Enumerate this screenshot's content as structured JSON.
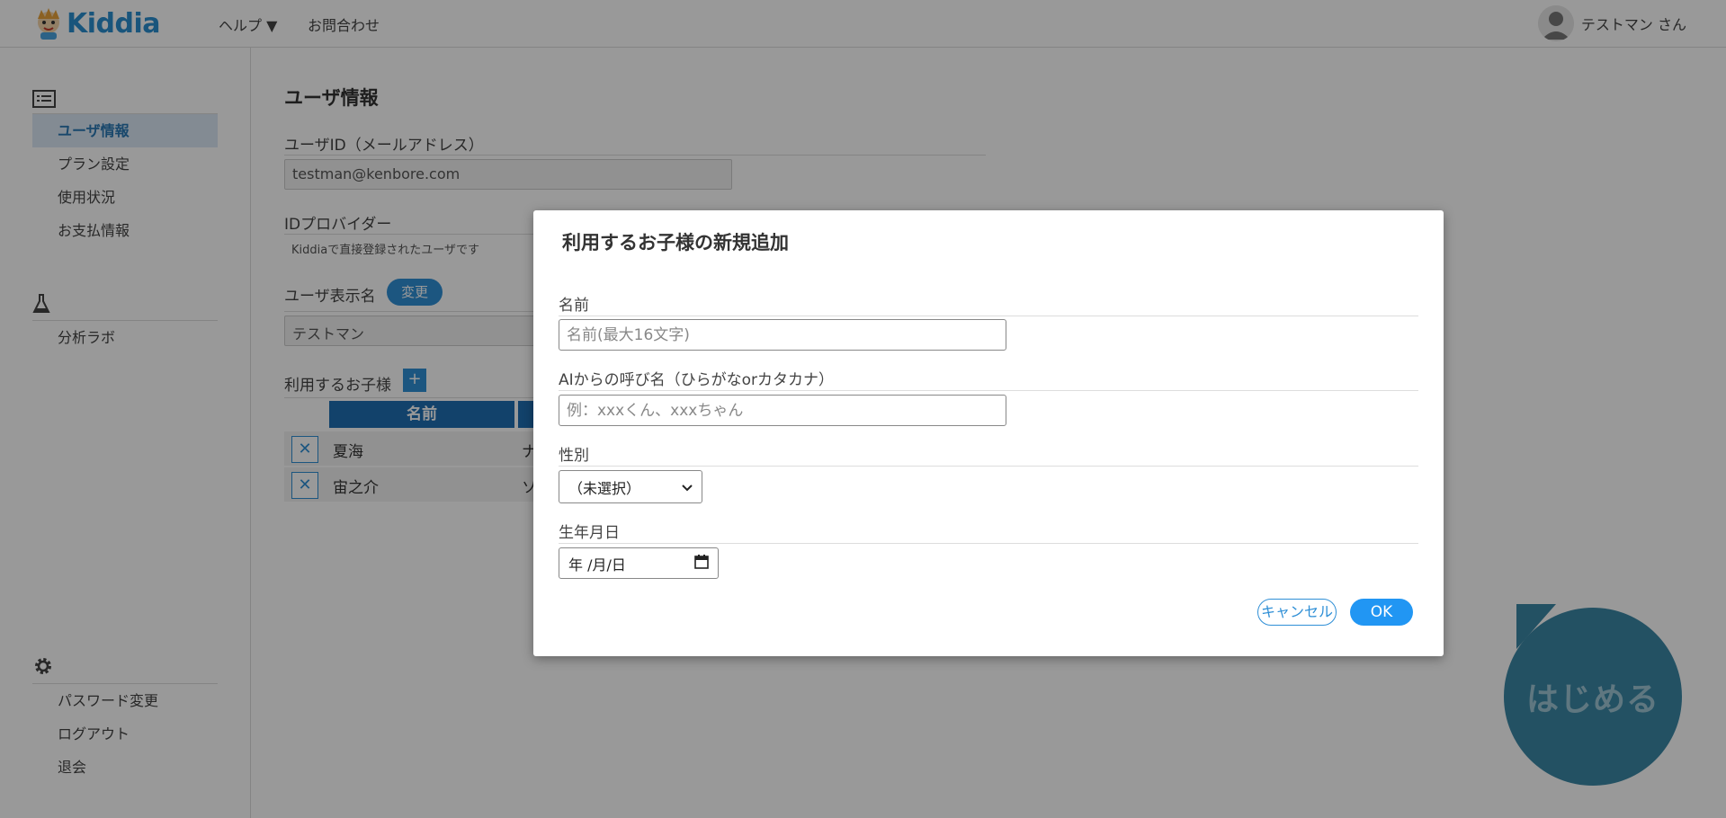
{
  "header": {
    "logo_text": "Kiddia",
    "nav": {
      "help": "ヘルプ ▼",
      "contact": "お問合わせ"
    },
    "user_name": "テストマン さん"
  },
  "sidebar": {
    "account_items": [
      {
        "label": "ユーザ情報",
        "active": true
      },
      {
        "label": "プラン設定"
      },
      {
        "label": "使用状況"
      },
      {
        "label": "お支払情報"
      }
    ],
    "lab_items": [
      {
        "label": "分析ラボ"
      }
    ],
    "settings_items": [
      {
        "label": "パスワード変更"
      },
      {
        "label": "ログアウト"
      },
      {
        "label": "退会"
      }
    ]
  },
  "main": {
    "title": "ユーザ情報",
    "user_id_label": "ユーザID（メールアドレス）",
    "user_id_value": "testman@kenbore.com",
    "id_provider_label": "IDプロバイダー",
    "id_provider_value": "Kiddiaで直接登録されたユーザです",
    "display_name_label": "ユーザ表示名",
    "change_button": "変更",
    "display_name_value": "テストマン",
    "children_label": "利用するお子様",
    "add_button": "+",
    "table_headers": [
      "名前"
    ],
    "children": [
      {
        "name": "夏海",
        "reading": "ナ"
      },
      {
        "name": "宙之介",
        "reading": "ソ"
      }
    ]
  },
  "start_button": "はじめる",
  "modal": {
    "title": "利用するお子様の新規追加",
    "name_label": "名前",
    "name_placeholder": "名前(最大16文字)",
    "nickname_label": "AIからの呼び名（ひらがなorカタカナ）",
    "nickname_placeholder": "例：xxxくん、xxxちゃん",
    "gender_label": "性別",
    "gender_value": "（未選択）",
    "birthday_label": "生年月日",
    "birthday_value": "年 /月/日",
    "cancel_button": "キャンセル",
    "ok_button": "OK"
  },
  "colors": {
    "brand_blue": "#2f8fd6",
    "header_dark_blue": "#1f6fb2",
    "start_bubble": "#3b87a6"
  }
}
